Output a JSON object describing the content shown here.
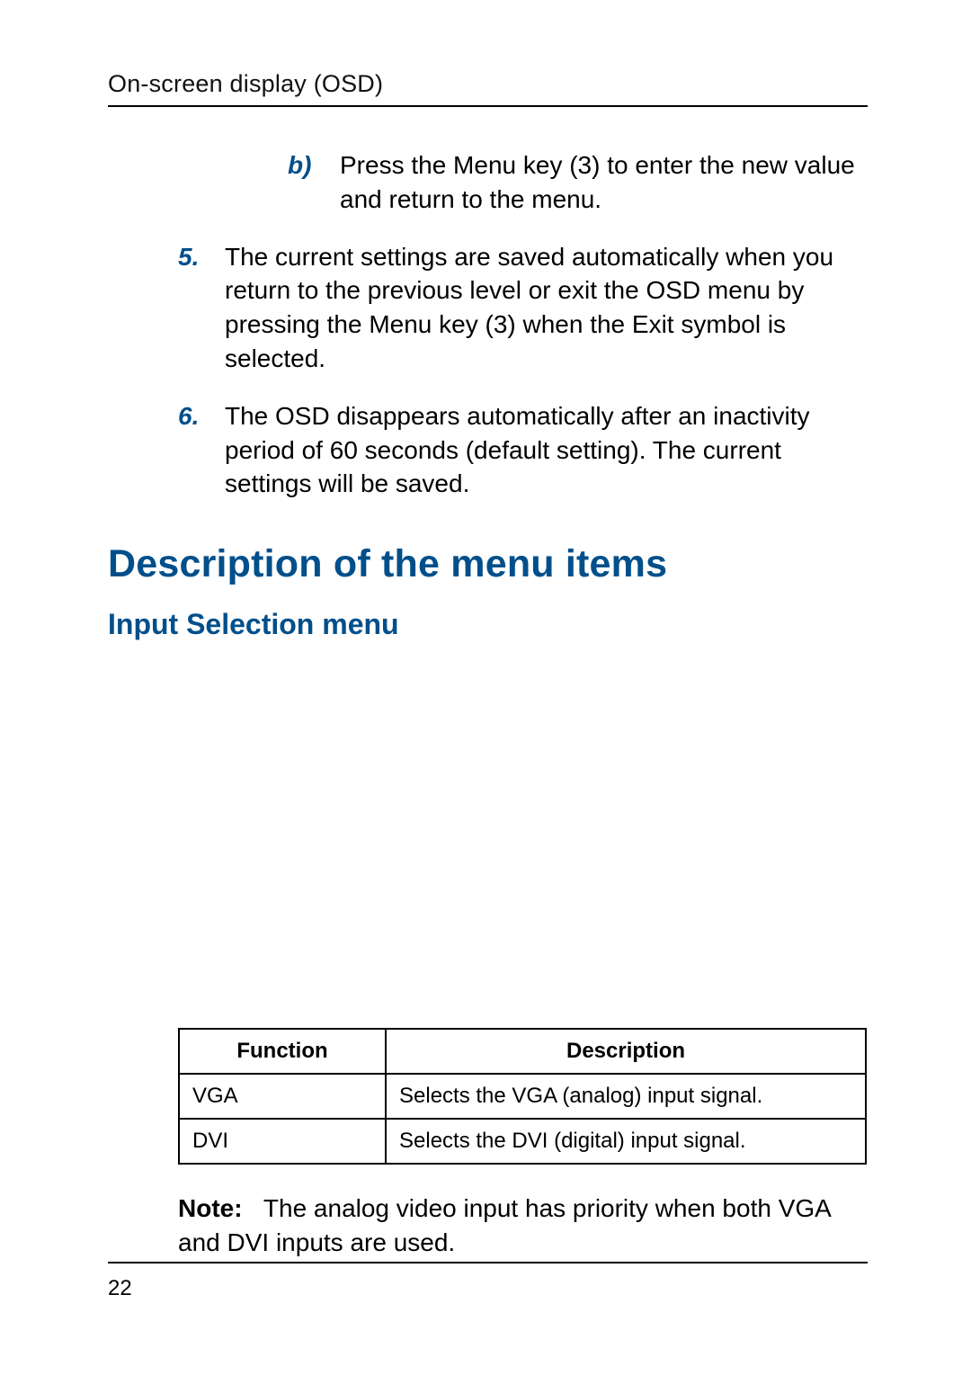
{
  "running_head": "On-screen display (OSD)",
  "list": {
    "item_b": {
      "marker": "b)",
      "text": "Press the Menu key (3) to enter the new value and return to the menu."
    },
    "item_5": {
      "marker": "5.",
      "text": "The current settings are saved automatically when you return to the previous level or exit the OSD menu by pressing the Menu key (3) when the Exit symbol is selected."
    },
    "item_6": {
      "marker": "6.",
      "text": "The OSD disappears automatically after an inactivity period of 60 seconds (default setting). The current settings will be saved."
    }
  },
  "section_title": "Description of the menu items",
  "subsection_title": "Input Selection menu",
  "table": {
    "headers": {
      "col1": "Function",
      "col2": "Description"
    },
    "rows": [
      {
        "func": "VGA",
        "desc": "Selects the VGA (analog) input signal."
      },
      {
        "func": "DVI",
        "desc": "Selects the DVI (digital) input signal."
      }
    ]
  },
  "note": {
    "label": "Note:",
    "text": "The analog video input has priority when both VGA and DVI inputs are used."
  },
  "page_number": "22"
}
